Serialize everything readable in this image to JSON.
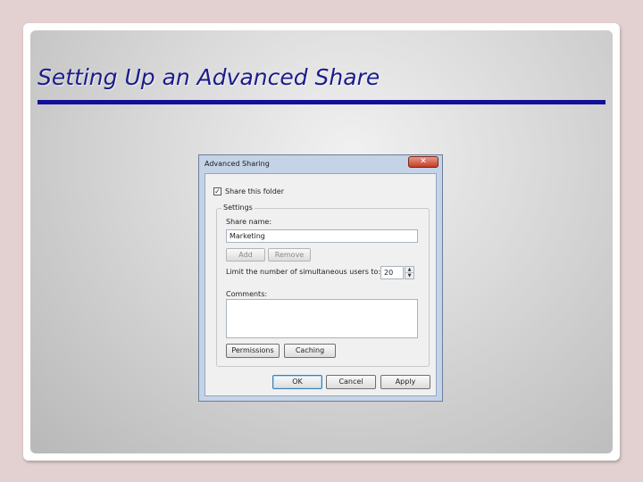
{
  "slide": {
    "title": "Setting Up an Advanced Share"
  },
  "dialog": {
    "title": "Advanced Sharing",
    "close_glyph": "✕",
    "share_checkbox": {
      "label": "Share this folder",
      "checked": true,
      "check_glyph": "✓"
    },
    "settings": {
      "legend": "Settings",
      "share_name_label": "Share name:",
      "share_name_value": "Marketing",
      "add_label": "Add",
      "remove_label": "Remove",
      "limit_label": "Limit the number of simultaneous users to:",
      "limit_value": "20",
      "spin_up_glyph": "▲",
      "spin_down_glyph": "▼",
      "comments_label": "Comments:",
      "comments_value": "",
      "permissions_label": "Permissions",
      "caching_label": "Caching"
    },
    "ok_label": "OK",
    "cancel_label": "Cancel",
    "apply_label": "Apply"
  },
  "colors": {
    "title_text": "#1c1c8c",
    "title_rule": "#10109a",
    "close_button": "#c43c24"
  }
}
